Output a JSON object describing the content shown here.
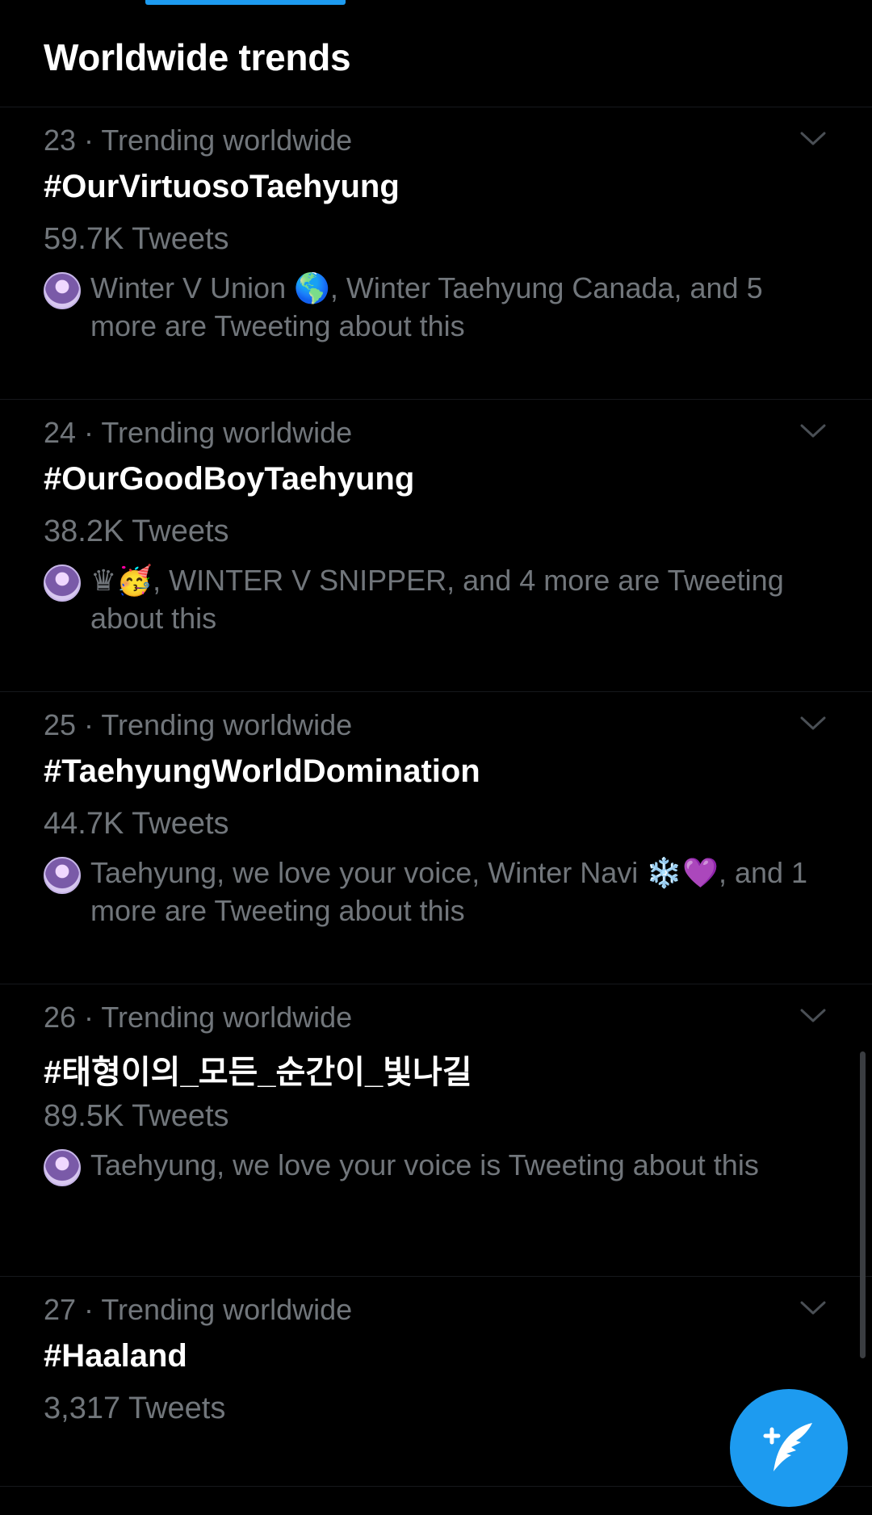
{
  "header": {
    "title": "Worldwide trends"
  },
  "trends": [
    {
      "meta": "23 · Trending worldwide",
      "name": "#OurVirtuosoTaehyung",
      "count": "59.7K Tweets",
      "context": "Winter V Union 🌎, Winter Taehyung Canada, and 5 more are Tweeting about this"
    },
    {
      "meta": "24 · Trending worldwide",
      "name": "#OurGoodBoyTaehyung",
      "count": "38.2K Tweets",
      "context": "♛🥳, WINTER V SNIPPER, and 4 more are Tweeting about this"
    },
    {
      "meta": "25 · Trending worldwide",
      "name": "#TaehyungWorldDomination",
      "count": "44.7K Tweets",
      "context": "Taehyung, we love your voice, Winter Navi ❄️💜, and 1 more are Tweeting about this"
    },
    {
      "meta": "26 · Trending worldwide",
      "name": "#태형이의_모든_순간이_빛나길",
      "count": "89.5K Tweets",
      "context": "Taehyung, we love your voice is Tweeting about this"
    },
    {
      "meta": "27 · Trending worldwide",
      "name": "#Haaland",
      "count": "3,317 Tweets"
    }
  ],
  "icons": {
    "chevron": "chevron-down-icon",
    "fab": "compose-tweet-icon"
  },
  "colors": {
    "accent": "#1d9bf0",
    "background": "#000000",
    "secondary_text": "#71767b"
  }
}
